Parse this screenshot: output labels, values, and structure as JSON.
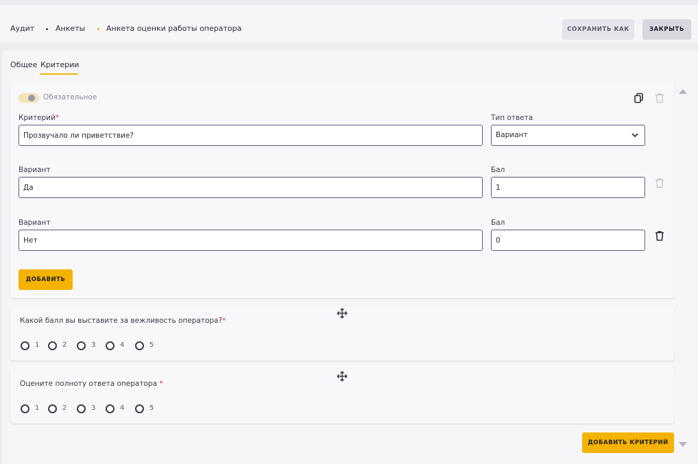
{
  "breadcrumb": {
    "items": [
      "Аудит",
      "Анкеты",
      "Анкета оценки работы оператора"
    ]
  },
  "header": {
    "save_as_label": "СОХРАНИТЬ КАК",
    "close_label": "ЗАКРЫТЬ"
  },
  "tabs": [
    {
      "label": "Общее",
      "active": false
    },
    {
      "label": "Критерии",
      "active": true
    }
  ],
  "criterion": {
    "required_label": "Обязательное",
    "criterion_label": "Критерий",
    "criterion_required_mark": "*",
    "criterion_value": "Прозвучало ли приветствие?",
    "answer_type_label": "Тип ответа",
    "answer_type_value": "Вариант",
    "variants": [
      {
        "variant_label": "Вариант",
        "variant_value": "Да",
        "score_label": "Бал",
        "score_value": "1"
      },
      {
        "variant_label": "Вариант",
        "variant_value": "Нет",
        "score_label": "Бал",
        "score_value": "0"
      }
    ],
    "add_label": "ДОБАВИТЬ"
  },
  "questions": [
    {
      "text": "Какой балл вы выставите за вежливость оператора?",
      "required_mark": "*",
      "options": [
        "1",
        "2",
        "3",
        "4",
        "5"
      ]
    },
    {
      "text": "Оцените полноту ответа оператора ",
      "required_mark": "*",
      "options": [
        "1",
        "2",
        "3",
        "4",
        "5"
      ]
    }
  ],
  "add_criterion_label": "ДОБАВИТЬ КРИТЕРИЙ",
  "colors": {
    "accent": "#f5b300",
    "required": "#d9381e"
  },
  "icons": {
    "copy": "copy-icon",
    "delete": "trash-icon",
    "drag": "move-icon",
    "dropdown": "chevron-down-icon"
  }
}
